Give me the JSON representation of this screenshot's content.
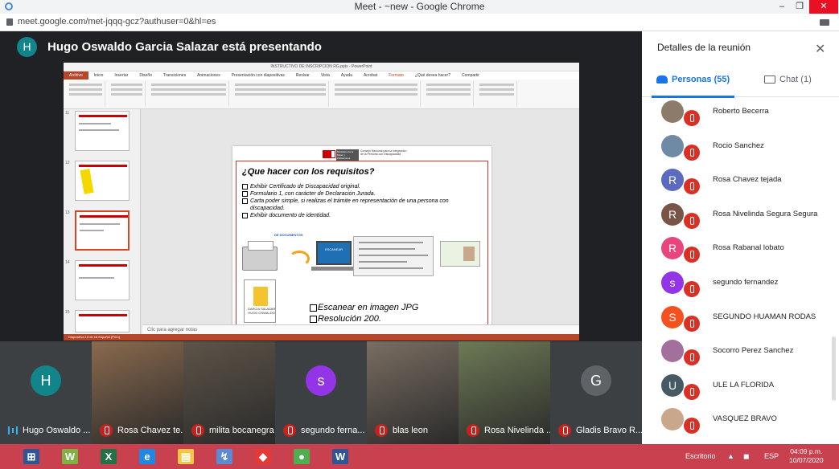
{
  "window": {
    "title": "Meet - ~new - Google Chrome",
    "minimize": "–",
    "maximize": "❐",
    "close": "✕"
  },
  "address": {
    "url": "meet.google.com/met-jqqq-gcz?authuser=0&hl=es"
  },
  "presenter": {
    "avatar_letter": "H",
    "text": "Hugo Oswaldo Garcia Salazar está presentando",
    "avatar_color": "#12858a"
  },
  "powerpoint": {
    "title": "INSTRUCTIVO DE INSCRIPCION RG.pptx - PowerPoint",
    "menu": [
      "Archivo",
      "Inicio",
      "Insertar",
      "Diseño",
      "Transiciones",
      "Animaciones",
      "Presentación con diapositivas",
      "Revisar",
      "Vista",
      "Ayuda",
      "Acrobat",
      "Formato",
      "¿Qué desea hacer?",
      "Compartir"
    ],
    "thumb_numbers": [
      "11",
      "12",
      "13",
      "14",
      "15"
    ],
    "notes_placeholder": "Clic para agregar notas",
    "status": "Diapositiva 13 de 18   Español (Perú)",
    "slide": {
      "logo_ministry": "Ministerio de la Mujer y Poblaciones Vulnerables",
      "logo_org": "Consejo Nacional para la Integración de la Persona con Discapacidad",
      "heading": "¿Que hacer con los requisitos?",
      "requirements": [
        "Exhibir Certificado de Discapacidad original.",
        "Formulario 1, con carácter de Declaración Jurada.",
        "Carta poder simple, si realizas el trámite en representación de una persona con discapacidad.",
        "Exhibir documento de identidad."
      ],
      "blue_label": "DE DOCUMENTOS",
      "laptop_label": "ESCANEAR",
      "folder_label": "GARCIA SALAZAR HUGO OSWALDO",
      "bottom": [
        "Escanear en imagen JPG",
        "Resolución 200."
      ]
    }
  },
  "tiles": [
    {
      "name": "Hugo Oswaldo ...",
      "avatar": "H",
      "color": "#12858a",
      "speaking": true
    },
    {
      "name": "Rosa Chavez te...",
      "avatar": "",
      "color": "#8a6a4e",
      "speaking": false
    },
    {
      "name": "milita bocanegra",
      "avatar": "",
      "color": "#5d5448",
      "speaking": false
    },
    {
      "name": "segundo ferna...",
      "avatar": "s",
      "color": "#9334e6",
      "speaking": false
    },
    {
      "name": "blas leon",
      "avatar": "",
      "color": "#7a6e62",
      "speaking": false
    },
    {
      "name": "Rosa Nivelinda ...",
      "avatar": "",
      "color": "#6d7a55",
      "speaking": false
    },
    {
      "name": "Gladis Bravo R...",
      "avatar": "G",
      "color": "#5f6368",
      "speaking": false
    }
  ],
  "panel": {
    "title": "Detalles de la reunión",
    "close": "✕",
    "tab_people": "Personas (55)",
    "tab_chat": "Chat (1)",
    "people": [
      {
        "name": "Roberto Becerra",
        "letter": "",
        "color": "#8d7b6a"
      },
      {
        "name": "Rocio Sanchez",
        "letter": "",
        "color": "#6f8aa5"
      },
      {
        "name": "Rosa Chavez tejada",
        "letter": "R",
        "color": "#5c6bc0"
      },
      {
        "name": "Rosa Nivelinda Segura Segura",
        "letter": "R",
        "color": "#795548"
      },
      {
        "name": "Rosa Rabanal lobato",
        "letter": "R",
        "color": "#e8457e"
      },
      {
        "name": "segundo fernandez",
        "letter": "s",
        "color": "#9334e6"
      },
      {
        "name": "SEGUNDO HUAMAN RODAS",
        "letter": "S",
        "color": "#f4511e"
      },
      {
        "name": "Socorro Perez Sanchez",
        "letter": "",
        "color": "#a36f9d"
      },
      {
        "name": "ULE LA FLORIDA",
        "letter": "U",
        "color": "#455a64"
      },
      {
        "name": "VASQUEZ BRAVO",
        "letter": "",
        "color": "#c9a78a"
      }
    ]
  },
  "taskbar": {
    "apps": [
      {
        "glyph": "⊞",
        "color": "#2b5797"
      },
      {
        "glyph": "W",
        "color": "#7cb342"
      },
      {
        "glyph": "X",
        "color": "#217346"
      },
      {
        "glyph": "e",
        "color": "#1e88e5"
      },
      {
        "glyph": "▤",
        "color": "#f2c744"
      },
      {
        "glyph": "↯",
        "color": "#5b8bd5"
      },
      {
        "glyph": "◆",
        "color": "#e53935"
      },
      {
        "glyph": "●",
        "color": "#4caf50"
      },
      {
        "glyph": "W",
        "color": "#2b579a"
      }
    ],
    "desktop": "Escritorio",
    "lang": "ESP",
    "time": "04:09 p.m.",
    "date": "10/07/2020"
  }
}
